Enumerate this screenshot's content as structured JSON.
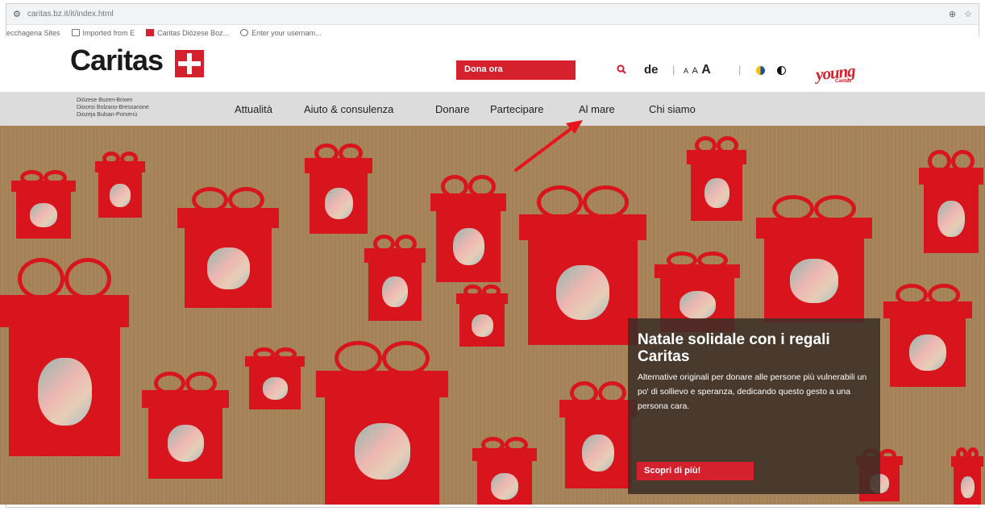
{
  "browser": {
    "url": "caritas.bz.it/it/index.html",
    "bookmarks": [
      "ecchagena Sites",
      "Imported from E",
      "Caritas Diözese Boz...",
      "Enter your usernam..."
    ]
  },
  "header": {
    "logo_text": "Caritas",
    "donate_label": "Dona ora",
    "language": "de",
    "separator": "|",
    "font_size": [
      "A",
      "A",
      "A"
    ],
    "young_logo": "young",
    "young_sub": "Caritas"
  },
  "nav": {
    "diocese_lines": [
      "Diözese Bozen-Brixen",
      "Diocesi Bolzano-Bressanone",
      "Diozeja Bulsan-Porsenù"
    ],
    "items": [
      "Attualità",
      "Aiuto & consulenza",
      "Donare",
      "Partecipare",
      "Al mare",
      "Chi siamo"
    ]
  },
  "hero": {
    "title": "Natale solidale con i regali Caritas",
    "text": "Alternative originali per donare alle persone più vulnerabili un po' di sollievo e speranza, dedicando questo gesto a una persona cara.",
    "cta_label": "Scopri di più!"
  },
  "colors": {
    "brand_red": "#d5202e",
    "hero_background": "#a8855b",
    "annotation_arrow": "#e8141c"
  },
  "icons": [
    "tune-icon",
    "zoom-icon",
    "star-icon",
    "search-icon",
    "contrast-icon",
    "high-contrast-icon"
  ]
}
